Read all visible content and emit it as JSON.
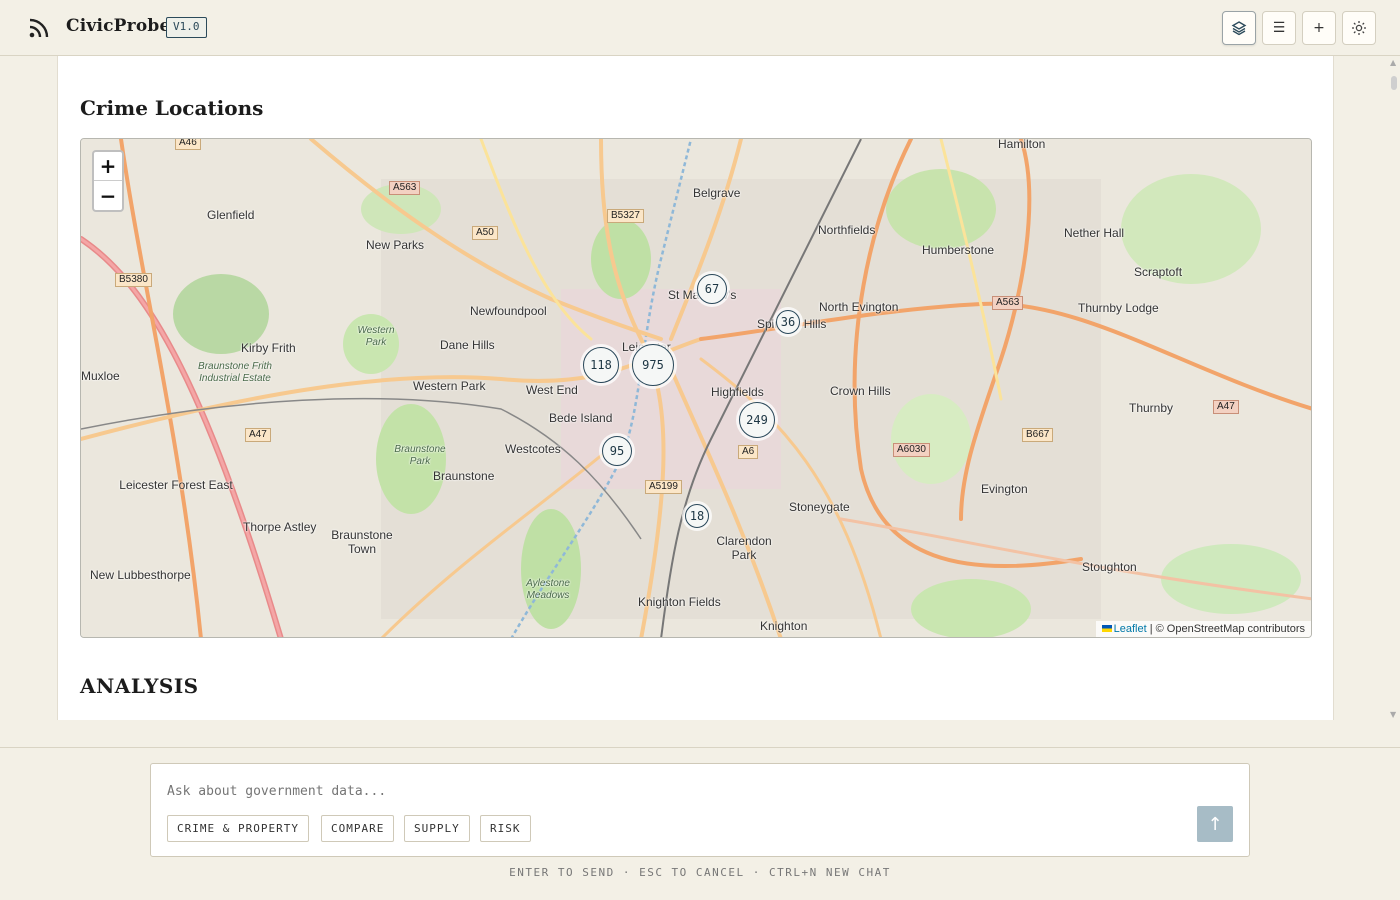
{
  "app": {
    "name": "CivicProbe",
    "version": "V1.0"
  },
  "header": {
    "buttons": [
      {
        "name": "layers",
        "icon": "layers-icon"
      },
      {
        "name": "menu",
        "icon": "list-icon",
        "glyph": "☰"
      },
      {
        "name": "new",
        "icon": "plus-icon",
        "glyph": "+"
      },
      {
        "name": "settings",
        "icon": "sun-icon"
      }
    ]
  },
  "section": {
    "title": "Crime Locations",
    "analysis_title": "ANALYSIS"
  },
  "map": {
    "zoom_in": "+",
    "zoom_out": "−",
    "clusters": [
      "67",
      "36",
      "118",
      "975",
      "249",
      "95",
      "18"
    ],
    "places": [
      "Hamilton",
      "Belgrave",
      "Northfields",
      "Humberstone",
      "Nether Hall",
      "Scraptoft",
      "Glenfield",
      "New Parks",
      "St Matthew's",
      "Spinney Hills",
      "North Evington",
      "Thurnby Lodge",
      "Newfoundpool",
      "Kirby Frith",
      "Dane Hills",
      "Leicester",
      "Highfields",
      "Crown Hills",
      "Muxloe",
      "Western Park",
      "West End",
      "Bede Island",
      "Thurnby",
      "Westcotes",
      "Braunstone",
      "Evington",
      "Leicester Forest East",
      "Stoneygate",
      "Thorpe Astley",
      "Braunstone Town",
      "Clarendon Park",
      "Stoughton",
      "New Lubbesthorpe",
      "Knighton Fields",
      "Knighton"
    ],
    "small_places": [
      "Western Park",
      "Braunstone Frith Industrial Estate",
      "Braunstone Park",
      "Aylestone Meadows"
    ],
    "roads": [
      "A46",
      "A563",
      "B5327",
      "A50",
      "B5380",
      "A563",
      "A47",
      "A6",
      "A6030",
      "B667",
      "A47",
      "A5199"
    ],
    "attribution_link": "Leaflet",
    "attribution_text": "| © OpenStreetMap contributors"
  },
  "composer": {
    "placeholder": "Ask about government data...",
    "chips": [
      "CRIME & PROPERTY",
      "COMPARE",
      "SUPPLY",
      "RISK"
    ],
    "send_glyph": "↑"
  },
  "hint": "ENTER TO SEND · ESC TO CANCEL · CTRL+N NEW CHAT"
}
